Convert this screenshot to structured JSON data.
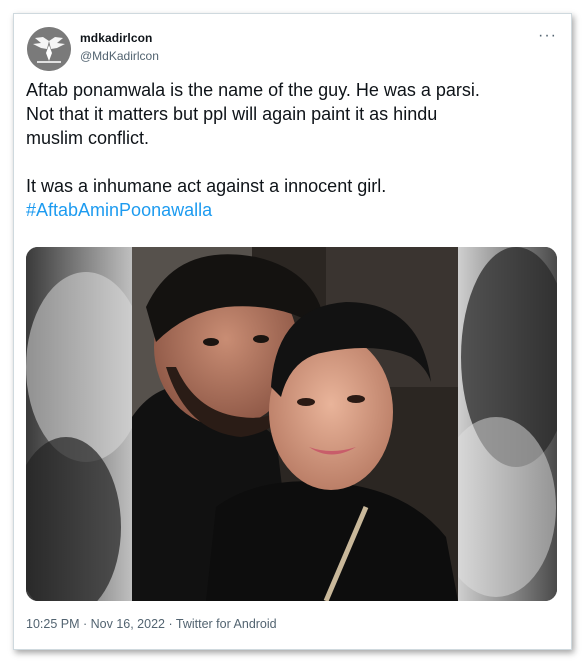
{
  "tweet": {
    "display_name": "mdkadirlcon",
    "handle": "@MdKadirlcon",
    "more_icon": "···",
    "text_lines": [
      "Aftab ponamwala is the name of the guy. He was a parsi.",
      "Not that it matters but ppl will again paint it as hindu",
      "muslim conflict."
    ],
    "text_line_2": "It was a inhumane act against a innocent girl.",
    "hashtag": "#AftabAminPoonawalla",
    "time": "10:25 PM",
    "separator": " · ",
    "date": "Nov 16, 2022",
    "source": "Twitter for Android"
  },
  "colors": {
    "text": "#0f1419",
    "secondary": "#536471",
    "link": "#1d9bf0",
    "border": "#cfd9de"
  }
}
